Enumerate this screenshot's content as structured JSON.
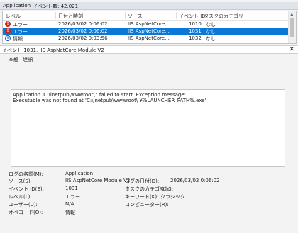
{
  "window": {
    "title": "Application",
    "event_count": "イベント数: 42,021"
  },
  "columns": [
    "レベル",
    "日付と時刻",
    "ソース",
    "イベント ID",
    "タスクのカテゴリ"
  ],
  "events": [
    {
      "icon": "error-icon",
      "level": "エラー",
      "datetime": "2026/03/02 0:06:02",
      "source": "IIS AspNetCore...",
      "id": "1010",
      "category": "なし",
      "selected": false
    },
    {
      "icon": "error-icon",
      "level": "エラー",
      "datetime": "2026/03/02 0:06:02",
      "source": "IIS AspNetCore...",
      "id": "1031",
      "category": "なし",
      "selected": true
    },
    {
      "icon": "info-icon",
      "level": "情報",
      "datetime": "2026/03/02 0:03:56",
      "source": "IIS AspNetCore...",
      "id": "1032",
      "category": "なし",
      "selected": false
    }
  ],
  "detail": {
    "title": "イベント 1031, IIS AspNetCore Module V2",
    "tabs": [
      "全般",
      "詳細"
    ],
    "message": [
      "Application 'C:\\inetpub\\wwwroot\\         ' failed to start. Exception message:",
      "Executable was not found at 'C:\\inetpub\\wwwroot\\         ¥%LAUNCHER_PATH%.exe'"
    ],
    "props": {
      "log_name_label": "ログの名前(M):",
      "log_name": "Application",
      "source_label": "ソース(S):",
      "source": "IIS AspNetCore Module V2",
      "logged_label": "ログの日付(D):",
      "logged": "2026/03/02 0:06:02",
      "event_id_label": "イベント ID(E):",
      "event_id": "1031",
      "task_label": "タスクのカテゴリ(Y):",
      "task": "なし",
      "level_label": "レベル(L):",
      "level": "エラー",
      "keywords_label": "キーワード(K):",
      "keywords": "クラシック",
      "user_label": "ユーザー(U):",
      "user": "N/A",
      "computer_label": "コンピューター(R):",
      "computer": "",
      "opcode_label": "オペコード(O):",
      "opcode": "情報"
    }
  }
}
